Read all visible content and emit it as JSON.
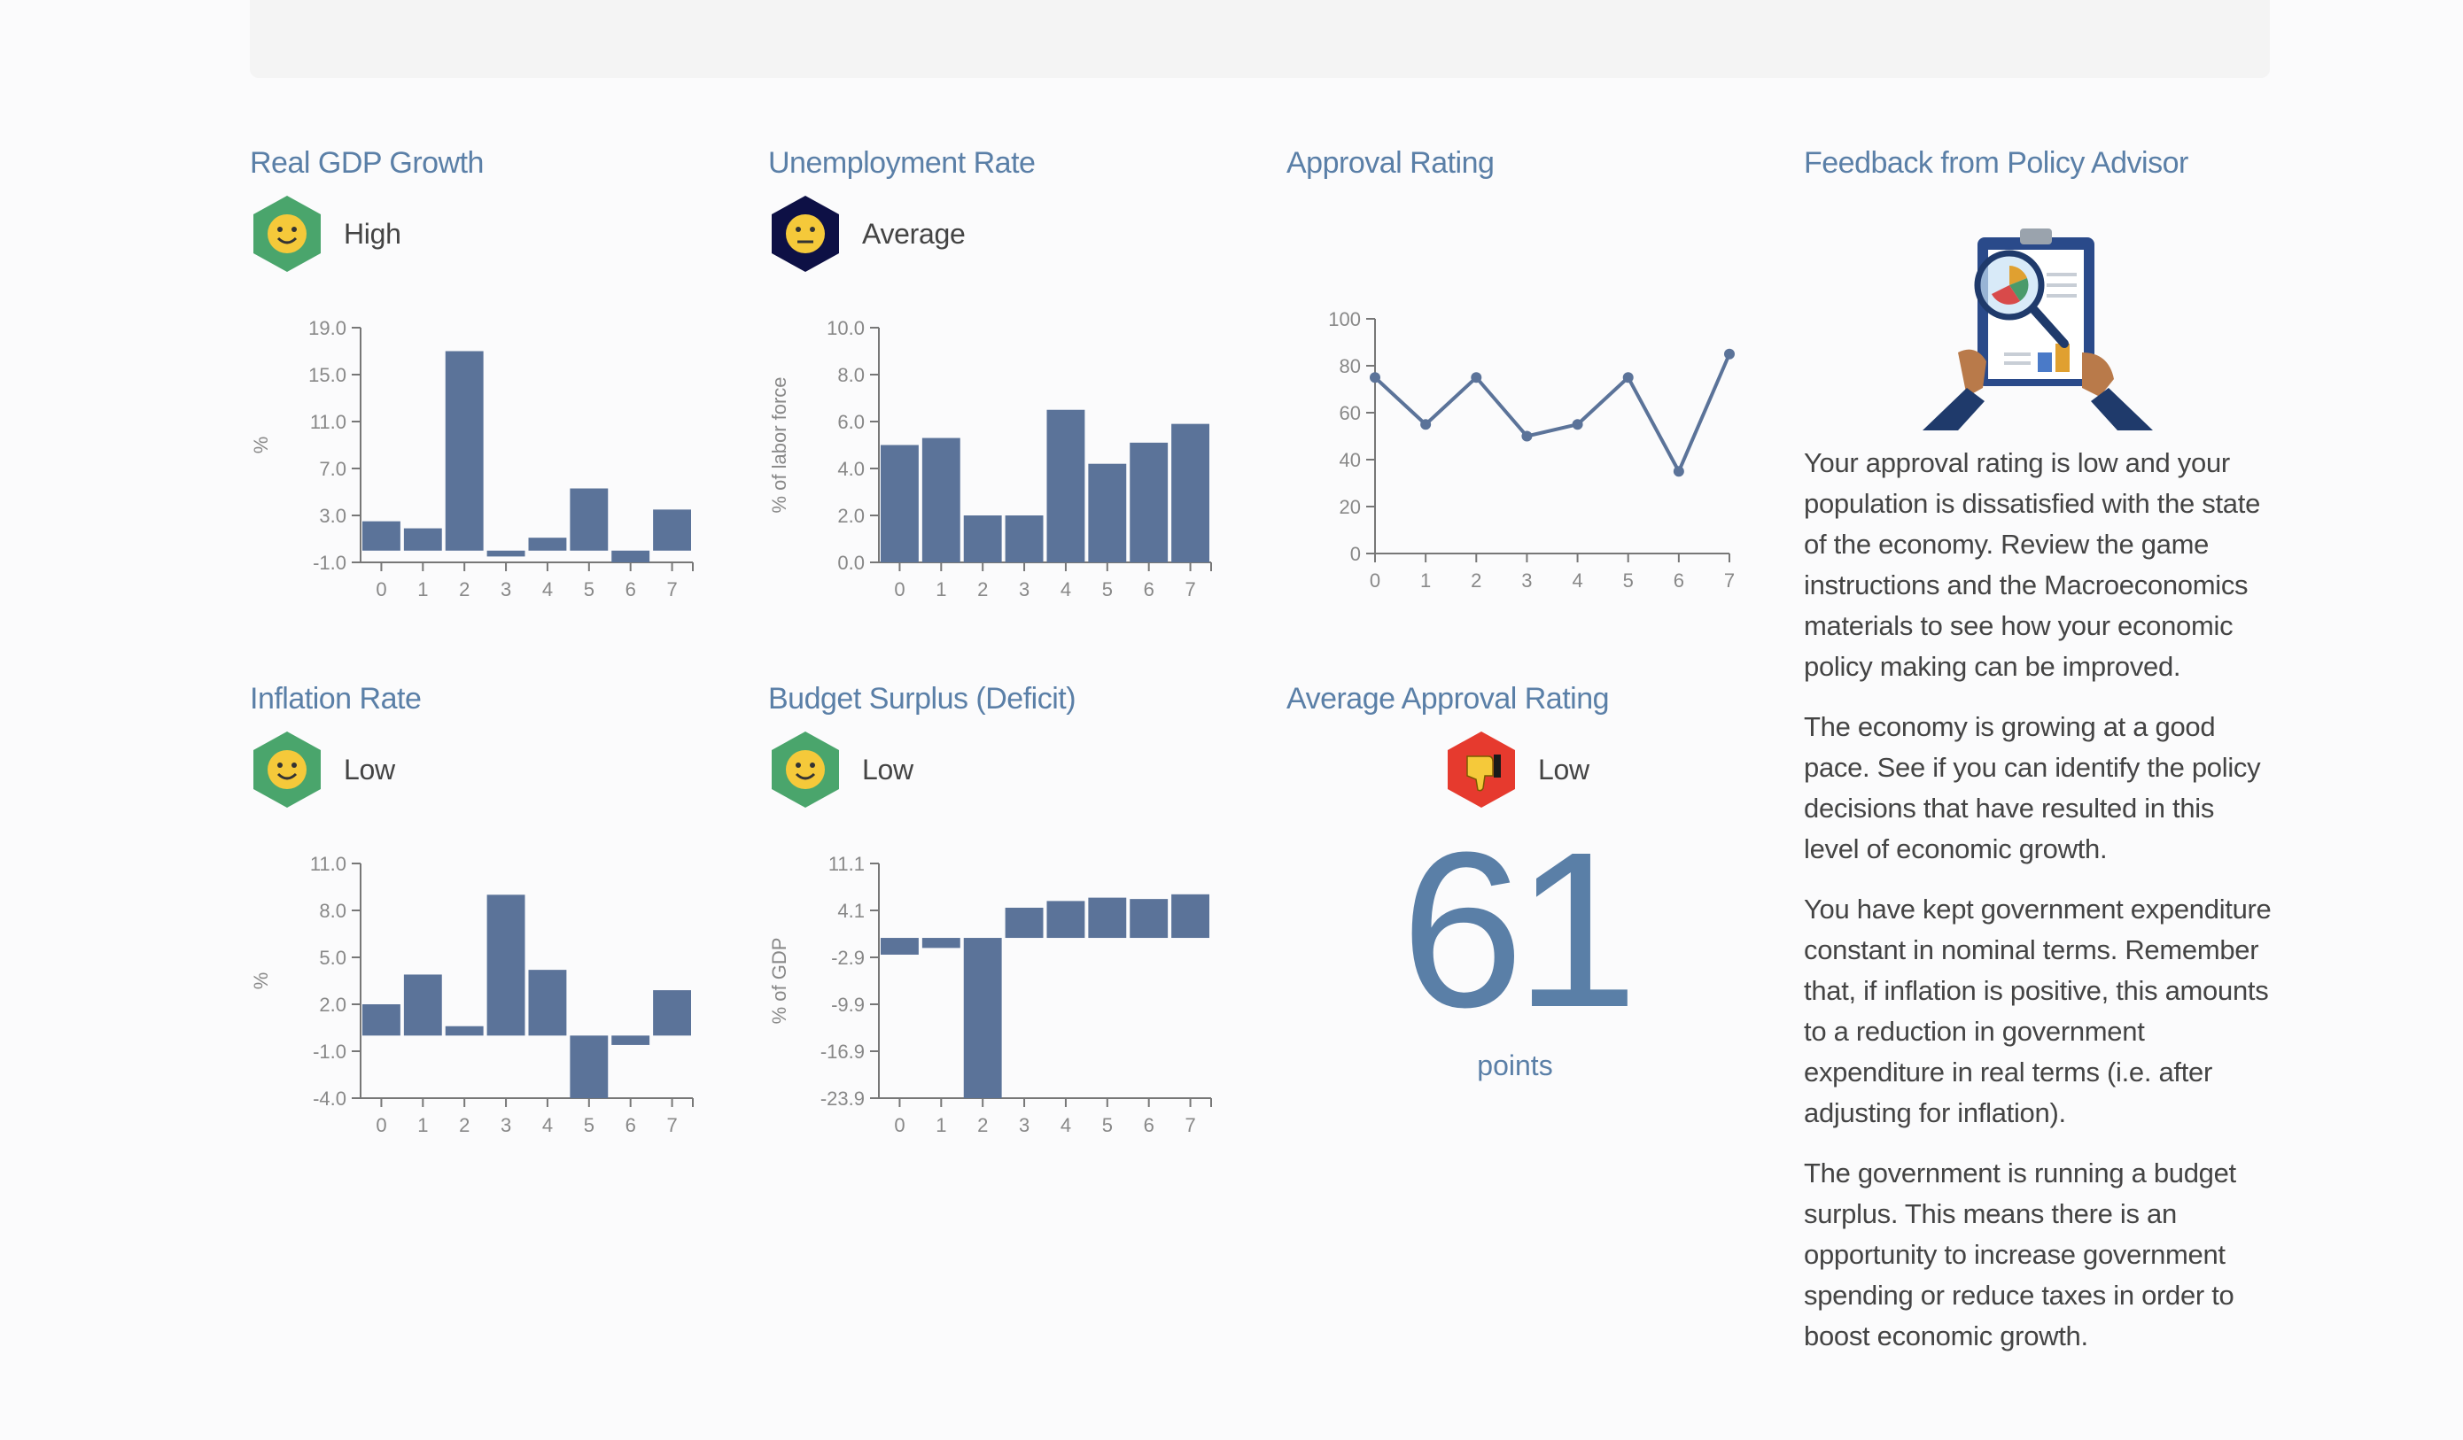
{
  "panels": {
    "gdp": {
      "title": "Real GDP Growth",
      "rating": "High",
      "icon": "happy-face-icon",
      "badge_color": "#4aa56c",
      "chart_data": {
        "type": "bar",
        "categories": [
          "0",
          "1",
          "2",
          "3",
          "4",
          "5",
          "6",
          "7"
        ],
        "values": [
          2.5,
          1.9,
          17.0,
          -0.5,
          1.1,
          5.3,
          -1.0,
          3.5
        ],
        "ylabel": "%",
        "yticks": [
          "19.0",
          "15.0",
          "11.0",
          "7.0",
          "3.0",
          "-1.0"
        ],
        "ylim": [
          -1.0,
          19.0
        ]
      }
    },
    "unemployment": {
      "title": "Unemployment Rate",
      "rating": "Average",
      "icon": "neutral-face-icon",
      "badge_color": "#0d1045",
      "chart_data": {
        "type": "bar",
        "categories": [
          "0",
          "1",
          "2",
          "3",
          "4",
          "5",
          "6",
          "7"
        ],
        "values": [
          5.0,
          5.3,
          2.0,
          2.0,
          6.5,
          4.2,
          5.1,
          5.9
        ],
        "ylabel": "% of labor force",
        "yticks": [
          "10.0",
          "8.0",
          "6.0",
          "4.0",
          "2.0",
          "0.0"
        ],
        "ylim": [
          0.0,
          10.0
        ]
      }
    },
    "approval": {
      "title": "Approval Rating",
      "chart_data": {
        "type": "line",
        "x": [
          0,
          1,
          2,
          3,
          4,
          5,
          6,
          7
        ],
        "values": [
          75,
          55,
          75,
          50,
          55,
          75,
          35,
          85
        ],
        "ylabel": "%",
        "yticks": [
          "100",
          "80",
          "60",
          "40",
          "20",
          "0"
        ],
        "ylim": [
          0,
          100
        ]
      }
    },
    "inflation": {
      "title": "Inflation Rate",
      "rating": "Low",
      "icon": "happy-face-icon",
      "badge_color": "#4aa56c",
      "chart_data": {
        "type": "bar",
        "categories": [
          "0",
          "1",
          "2",
          "3",
          "4",
          "5",
          "6",
          "7"
        ],
        "values": [
          2.0,
          3.9,
          0.6,
          9.0,
          4.2,
          -4.0,
          -0.6,
          2.9
        ],
        "ylabel": "%",
        "yticks": [
          "11.0",
          "8.0",
          "5.0",
          "2.0",
          "-1.0",
          "-4.0"
        ],
        "ylim": [
          -4.0,
          11.0
        ]
      }
    },
    "budget": {
      "title": "Budget Surplus (Deficit)",
      "rating": "Low",
      "icon": "happy-face-icon",
      "badge_color": "#4aa56c",
      "chart_data": {
        "type": "bar",
        "categories": [
          "0",
          "1",
          "2",
          "3",
          "4",
          "5",
          "6",
          "7"
        ],
        "values": [
          -2.5,
          -1.5,
          -23.9,
          4.5,
          5.5,
          6.0,
          5.8,
          6.5
        ],
        "ylabel": "% of GDP",
        "yticks": [
          "11.1",
          "4.1",
          "-2.9",
          "-9.9",
          "-16.9",
          "-23.9"
        ],
        "ylim": [
          -23.9,
          11.1
        ]
      }
    },
    "avg_approval": {
      "title": "Average Approval Rating",
      "rating": "Low",
      "icon": "thumbs-down-icon",
      "badge_color": "#e63a2e",
      "score": "61",
      "unit": "points"
    }
  },
  "feedback": {
    "title": "Feedback from Policy Advisor",
    "illustration": "clipboard-magnifier-icon",
    "paragraphs": [
      "Your approval rating is low and your population is dissatisfied with the state of the economy. Review the game instructions and the Macroeconomics materials to see how your economic policy making can be improved.",
      "The economy is growing at a good pace. See if you can identify the policy decisions that have resulted in this level of economic growth.",
      "You have kept government expenditure constant in nominal terms. Remember that, if inflation is positive, this amounts to a reduction in government expenditure in real terms (i.e. after adjusting for inflation).",
      "The government is running a budget surplus. This means there is an opportunity to increase government spending or reduce taxes in order to boost economic growth."
    ]
  },
  "colors": {
    "accent": "#5a7fa7",
    "bar": "#5b7399",
    "axis": "#777777"
  }
}
